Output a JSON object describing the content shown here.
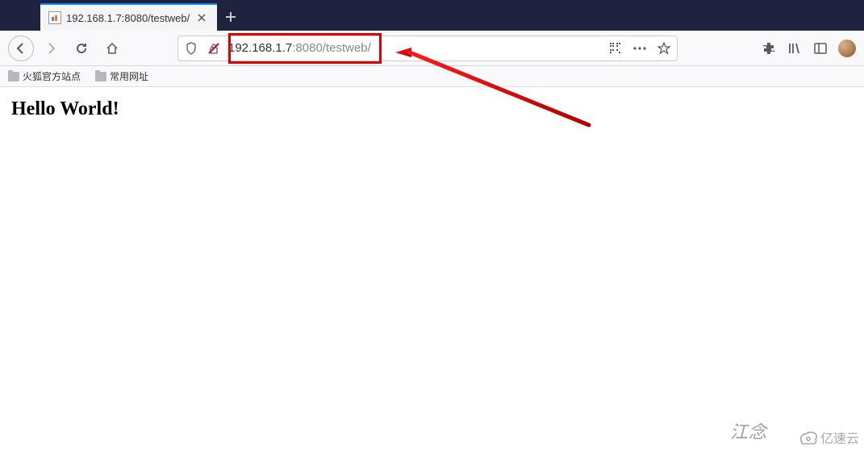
{
  "tab": {
    "title": "192.168.1.7:8080/testweb/"
  },
  "address": {
    "host": "192.168.1.7",
    "port_path": ":8080/testweb/",
    "full": "192.168.1.7:8080/testweb/"
  },
  "bookmarks": {
    "item1": "火狐官方站点",
    "item2": "常用网址"
  },
  "page": {
    "heading": "Hello World!"
  },
  "watermark": {
    "text": "江念",
    "logo_text": "亿速云"
  }
}
